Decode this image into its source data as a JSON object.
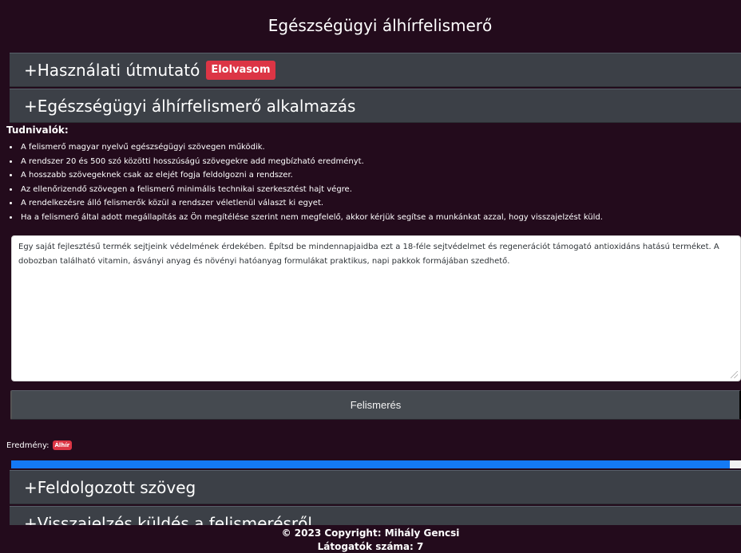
{
  "header": {
    "title": "Egészségügyi álhírfelismerő"
  },
  "sections": {
    "guide": {
      "title": "+Használati útmutató",
      "badge": "Elolvasom"
    },
    "app": {
      "title": "+Egészségügyi álhírfelismerő alkalmazás"
    },
    "processed": {
      "title": "+Feldolgozott szöveg"
    },
    "feedback": {
      "title": "+Visszajelzés küldés a felismerésről"
    }
  },
  "notes": {
    "title": "Tudnivalók:",
    "items": [
      "A felismerő magyar nyelvű egészségügyi szövegen működik.",
      "A rendszer 20 és 500 szó közötti hosszúságú szövegekre add megbízható eredményt.",
      "A hosszabb szövegeknek csak az elejét fogja feldolgozni a rendszer.",
      "Az ellenőrizendő szövegen a felismerő minimális technikai szerkesztést hajt végre.",
      "A rendelkezésre álló felismerők közül a rendszer véletlenül választ ki egyet.",
      "Ha a felismerő által adott megállapítás az Ön megítélése szerint nem megfelelő, akkor kérjük segítse a munkánkat azzal, hogy visszajelzést küld."
    ]
  },
  "input": {
    "text": "Egy saját fejlesztésű termék sejtjeink védelmének érdekében. Építsd be mindennapjaidba ezt a 18-féle sejtvédelmet és regenerációt támogató antioxidáns hatású terméket. A dobozban található vitamin, ásványi anyag és növényi hatóanyag formulákat praktikus, napi pakkok formájában szedhető."
  },
  "actions": {
    "recognize_label": "Felismerés"
  },
  "result": {
    "label": "Eredmény:",
    "value": "Álhír",
    "progress": 0.985
  },
  "footer": {
    "copyright": "© 2023 Copyright: Mihály Gencsi",
    "visitors": "Látogatók száma: 7"
  },
  "colors": {
    "background": "#230b1c",
    "section": "#3c4047",
    "accent_red": "#dc3545",
    "progress_blue": "#1479f4"
  }
}
